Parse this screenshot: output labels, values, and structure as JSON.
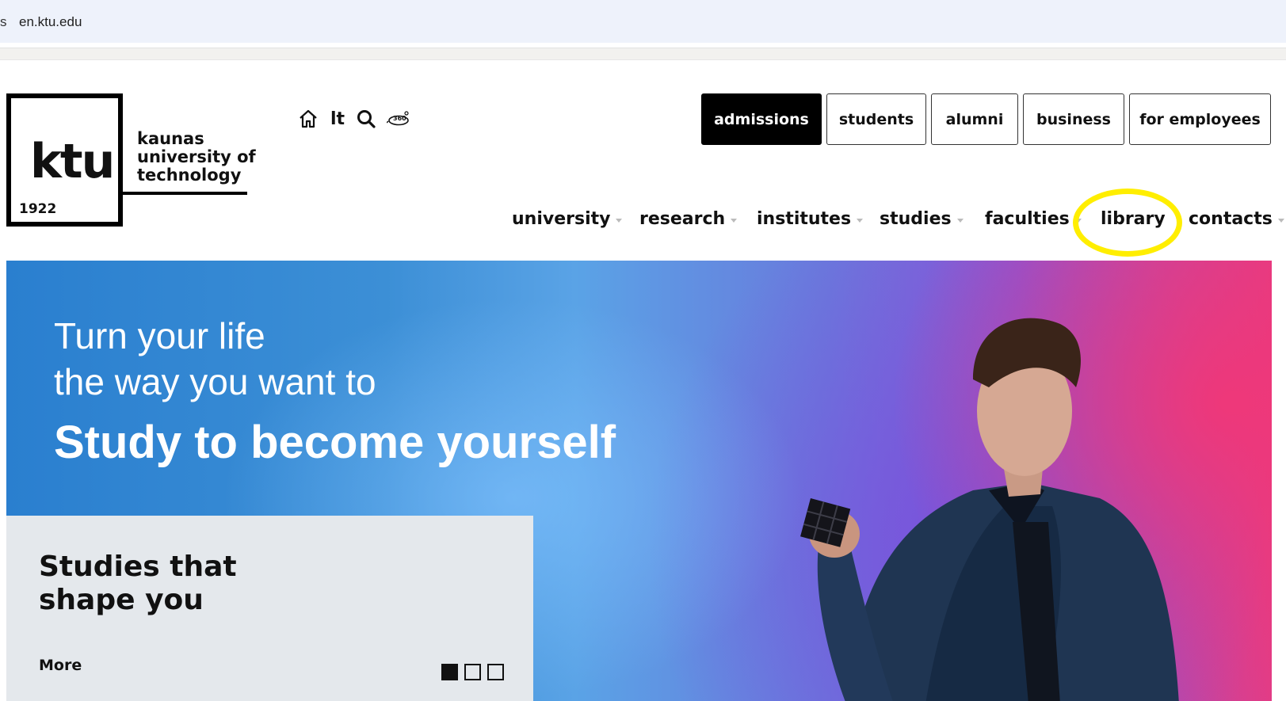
{
  "browser": {
    "lead_char": "s",
    "url": "en.ktu.edu"
  },
  "logo": {
    "mark": "ktu",
    "year": "1922",
    "name_lines": [
      "kaunas",
      "university of",
      "technology"
    ]
  },
  "utility": {
    "language": "lt",
    "icons": [
      "home-icon",
      "search-icon",
      "360-tour-icon"
    ]
  },
  "audience_buttons": [
    {
      "label": "admissions",
      "active": true
    },
    {
      "label": "students",
      "active": false
    },
    {
      "label": "alumni",
      "active": false
    },
    {
      "label": "business",
      "active": false
    },
    {
      "label": "for employees",
      "active": false
    }
  ],
  "nav": [
    {
      "label": "university",
      "has_dropdown": true
    },
    {
      "label": "research",
      "has_dropdown": true
    },
    {
      "label": "institutes",
      "has_dropdown": true
    },
    {
      "label": "studies",
      "has_dropdown": true
    },
    {
      "label": "faculties",
      "has_dropdown": true
    },
    {
      "label": "library",
      "has_dropdown": false,
      "highlighted": true
    },
    {
      "label": "contacts",
      "has_dropdown": true
    }
  ],
  "hero": {
    "line1": "Turn your life",
    "line2": "the way you want to",
    "title": "Study to become yourself",
    "card": {
      "title_lines": [
        "Studies that",
        "shape you"
      ],
      "more_label": "More",
      "slides_total": 3,
      "slide_active": 1
    }
  },
  "colors": {
    "highlight": "#ffee00",
    "button_dark": "#000000",
    "card_bg": "#e4e8ec"
  }
}
